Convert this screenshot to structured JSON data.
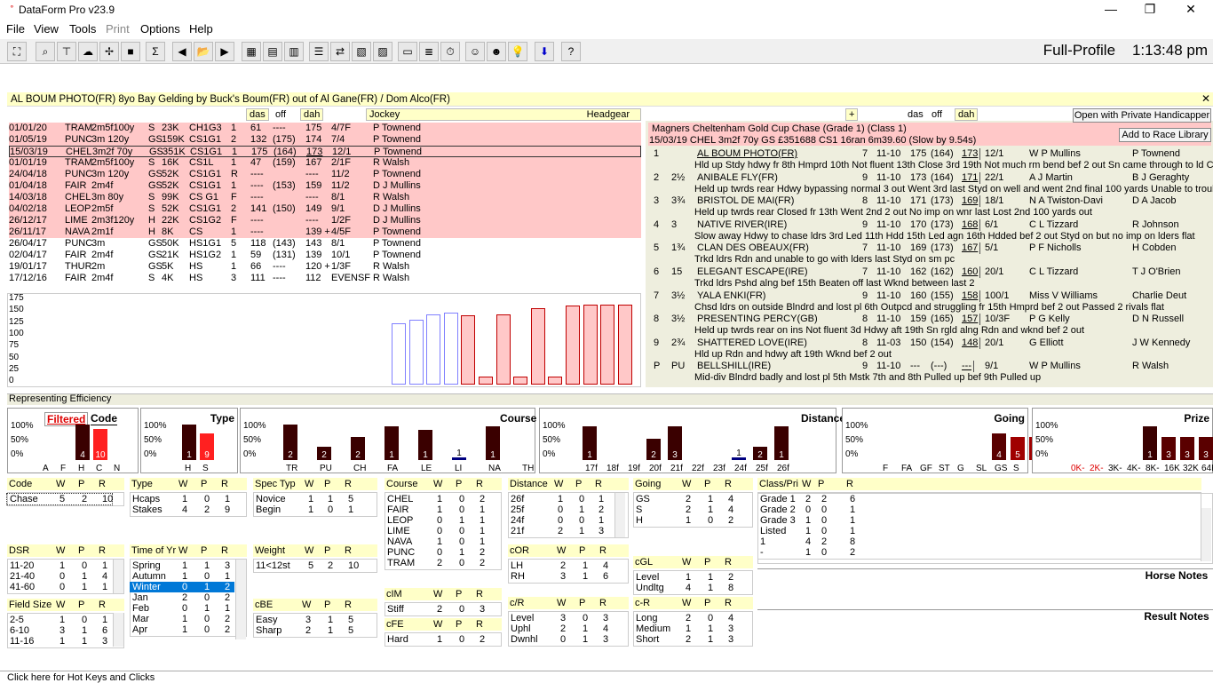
{
  "app": {
    "title": "DataForm Pro v23.9",
    "profile": "Full-Profile",
    "time": "1:13:48 pm"
  },
  "menu": [
    "File",
    "View",
    "Tools",
    "Print",
    "Options",
    "Help"
  ],
  "horse": "AL BOUM PHOTO(FR)    8yo  Bay Gelding  by Buck's Boum(FR) out of Al Gane(FR) / Dom Alco(FR)",
  "form_headers": {
    "das": "das",
    "off": "off",
    "dah": "dah",
    "jockey": "Jockey",
    "headgear": "Headgear"
  },
  "form": [
    {
      "date": "01/01/20",
      "course": "TRAM",
      "dist": "2m5f100y",
      "going": "S",
      "prize": "23K",
      "cls": "CH1G3",
      "pos": "1",
      "das": "61",
      "off": "----",
      "dah": "175",
      "sp": "4/7F",
      "jockey": "P Townend",
      "pink": true
    },
    {
      "date": "01/05/19",
      "course": "PUNC",
      "dist": "3m 120y",
      "going": "GS",
      "prize": "159K",
      "cls": "CS1G1",
      "pos": "2",
      "das": "132",
      "off": "(175)",
      "dah": "174",
      "sp": "7/4",
      "jockey": "P Townend",
      "pink": true
    },
    {
      "date": "15/03/19",
      "course": "CHEL",
      "dist": "3m2f 70y",
      "going": "GS",
      "prize": "351K",
      "cls": "CS1G1",
      "pos": "1",
      "das": "175",
      "off": "(164)",
      "dah": "173",
      "sp": "12/1",
      "jockey": "P Townend",
      "pink": true
    },
    {
      "date": "01/01/19",
      "course": "TRAM",
      "dist": "2m5f100y",
      "going": "S",
      "prize": "16K",
      "cls": "CS1L",
      "pos": "1",
      "das": "47",
      "off": "(159)",
      "dah": "167",
      "sp": "2/1F",
      "jockey": "R Walsh",
      "pink": true
    },
    {
      "date": "24/04/18",
      "course": "PUNC",
      "dist": "3m 120y",
      "going": "GS",
      "prize": "52K",
      "cls": "CS1G1",
      "pos": "R",
      "das": "----",
      "off": "",
      "dah": "----",
      "sp": "11/2",
      "jockey": "P Townend",
      "pink": true
    },
    {
      "date": "01/04/18",
      "course": "FAIR",
      "dist": "2m4f",
      "going": "GS",
      "prize": "52K",
      "cls": "CS1G1",
      "pos": "1",
      "das": "----",
      "off": "(153)",
      "dah": "159",
      "sp": "11/2",
      "jockey": "D J Mullins",
      "pink": true
    },
    {
      "date": "14/03/18",
      "course": "CHEL",
      "dist": "3m  80y",
      "going": "S",
      "prize": "99K",
      "cls": "CS G1",
      "pos": "F",
      "das": "----",
      "off": "",
      "dah": "----",
      "sp": "8/1",
      "jockey": "R Walsh",
      "pink": true
    },
    {
      "date": "04/02/18",
      "course": "LEOP",
      "dist": "2m5f",
      "going": "S",
      "prize": "52K",
      "cls": "CS1G1",
      "pos": "2",
      "das": "141",
      "off": "(150)",
      "dah": "149",
      "sp": "9/1",
      "jockey": "D J Mullins",
      "pink": true
    },
    {
      "date": "26/12/17",
      "course": "LIME",
      "dist": "2m3f120y",
      "going": "H",
      "prize": "22K",
      "cls": "CS1G2",
      "pos": "F",
      "das": "----",
      "off": "",
      "dah": "----",
      "sp": "1/2F",
      "jockey": "D J Mullins",
      "pink": true
    },
    {
      "date": "26/11/17",
      "course": "NAVA",
      "dist": "2m1f",
      "going": "H",
      "prize": "8K",
      "cls": "CS",
      "pos": "1",
      "das": "----",
      "off": "",
      "dah": "139 +",
      "sp": "4/5F",
      "jockey": "P Townend",
      "pink": true
    },
    {
      "date": "26/04/17",
      "course": "PUNC",
      "dist": "3m",
      "going": "GS",
      "prize": "50K",
      "cls": "HS1G1",
      "pos": "5",
      "das": "118",
      "off": "(143)",
      "dah": "143",
      "sp": "8/1",
      "jockey": "P Townend",
      "pink": false
    },
    {
      "date": "02/04/17",
      "course": "FAIR",
      "dist": "2m4f",
      "going": "GS",
      "prize": "21K",
      "cls": "HS1G2",
      "pos": "1",
      "das": "59",
      "off": "(131)",
      "dah": "139",
      "sp": "10/1",
      "jockey": "P Townend",
      "pink": false
    },
    {
      "date": "19/01/17",
      "course": "THUR",
      "dist": "2m",
      "going": "GS",
      "prize": "5K",
      "cls": "HS",
      "pos": "1",
      "das": "66",
      "off": "----",
      "dah": "120 +",
      "sp": "1/3F",
      "jockey": "R Walsh",
      "pink": false
    },
    {
      "date": "17/12/16",
      "course": "FAIR",
      "dist": "2m4f",
      "going": "S",
      "prize": "4K",
      "cls": "HS",
      "pos": "3",
      "das": "111",
      "off": "----",
      "dah": "112",
      "sp": "EVENSF",
      "jockey": "R Walsh",
      "pink": false
    }
  ],
  "rating_chart": {
    "ylabels": [
      "175",
      "150",
      "125",
      "100",
      "75",
      "50",
      "25",
      "0"
    ],
    "values": [
      120,
      127,
      138,
      142,
      137,
      15,
      138,
      15,
      150,
      15,
      155,
      157,
      158,
      158
    ],
    "pink": [
      false,
      false,
      false,
      false,
      true,
      true,
      true,
      true,
      true,
      true,
      true,
      true,
      true,
      true
    ]
  },
  "race": {
    "title": "Magners Cheltenham Gold Cup Chase (Grade 1) (Class 1)",
    "subtitle": "15/03/19 CHEL 3m2f 70y  GS  £351688   CS1 16ran 6m39.60 (Slow by 9.54s)",
    "plus": "+",
    "das": "das",
    "off": "off",
    "dah": "dah",
    "btn_private": "Open with Private Handicapper",
    "btn_library": "Add to Race Library",
    "runners": [
      {
        "pos": "1",
        "btn": "",
        "name": "AL BOUM PHOTO(FR)",
        "age": "7",
        "wt": "11-10",
        "r1": "175",
        "r2": "(164)",
        "r3": "173",
        "sp": "12/1",
        "jockey": "P Townend",
        "trainer": "W P Mullins",
        "comment": "Hld up Stdy hdwy fr 8th Hmprd 10th Not fluent 13th Close 3rd 19th Not much rm bend bef 2 out Sn came through to ld Clr fnl"
      },
      {
        "pos": "2",
        "btn": "2½",
        "name": "ANIBALE FLY(FR)",
        "age": "9",
        "wt": "11-10",
        "r1": "173",
        "r2": "(164)",
        "r3": "171",
        "sp": "22/1",
        "jockey": "B J Geraghty",
        "trainer": "A J Martin",
        "comment": "Held up twrds rear Hdwy bypassing normal 3 out Went 3rd last Styd on well and went 2nd final 100 yards Unable to trouble w"
      },
      {
        "pos": "3",
        "btn": "3¾",
        "name": "BRISTOL DE MAI(FR)",
        "age": "8",
        "wt": "11-10",
        "r1": "171",
        "r2": "(173)",
        "r3": "169",
        "sp": "18/1",
        "jockey": "D A Jacob",
        "trainer": "N A Twiston-Davi",
        "comment": "Held up twrds rear Closed fr 13th Went 2nd 2 out No imp on wnr last Lost 2nd 100 yards out"
      },
      {
        "pos": "4",
        "btn": "3",
        "name": "NATIVE RIVER(IRE)",
        "age": "9",
        "wt": "11-10",
        "r1": "170",
        "r2": "(173)",
        "r3": "168",
        "sp": "6/1",
        "jockey": "R Johnson",
        "trainer": "C L Tizzard",
        "comment": "Slow away Hdwy to chase ldrs 3rd Led 11th Hdd 15th Led agn 16th Hdded bef 2 out Styd on but no imp on lders flat"
      },
      {
        "pos": "5",
        "btn": "1¾",
        "name": "CLAN DES OBEAUX(FR)",
        "age": "7",
        "wt": "11-10",
        "r1": "169",
        "r2": "(173)",
        "r3": "167",
        "sp": "5/1",
        "jockey": "H Cobden",
        "trainer": "P F Nicholls",
        "comment": "Trkd ldrs Rdn and unable to go with lders last Styd on sm pc"
      },
      {
        "pos": "6",
        "btn": "15",
        "name": "ELEGANT ESCAPE(IRE)",
        "age": "7",
        "wt": "11-10",
        "r1": "162",
        "r2": "(162)",
        "r3": "160",
        "sp": "20/1",
        "jockey": "T J O'Brien",
        "trainer": "C L Tizzard",
        "comment": "Trkd ldrs Pshd alng bef 15th Beaten off last Wknd between last 2"
      },
      {
        "pos": "7",
        "btn": "3½",
        "name": "YALA ENKI(FR)",
        "age": "9",
        "wt": "11-10",
        "r1": "160",
        "r2": "(155)",
        "r3": "158",
        "sp": "100/1",
        "jockey": "Charlie Deut",
        "trainer": "Miss V Williams",
        "comment": "Chsd ldrs on outside Blndrd and lost pl 6th Outpcd and struggling fr 15th Hmprd bef 2 out Passed 2 rivals flat"
      },
      {
        "pos": "8",
        "btn": "3½",
        "name": "PRESENTING PERCY(GB)",
        "age": "8",
        "wt": "11-10",
        "r1": "159",
        "r2": "(165)",
        "r3": "157",
        "sp": "10/3F",
        "jockey": "D N Russell",
        "trainer": "P G Kelly",
        "comment": "Held up twrds rear on ins Not fluent 3d Hdwy aft 19th Sn rgld alng Rdn and wknd bef 2 out"
      },
      {
        "pos": "9",
        "btn": "2¾",
        "name": "SHATTERED LOVE(IRE)",
        "age": "8",
        "wt": "11-03",
        "r1": "150",
        "r2": "(154)",
        "r3": "148",
        "sp": "20/1",
        "jockey": "J W Kennedy",
        "trainer": "G Elliott",
        "comment": "Hld up Rdn and hdwy aft 19th Wknd bef 2 out"
      },
      {
        "pos": "P",
        "btn": "PU",
        "name": "BELLSHILL(IRE)",
        "age": "9",
        "wt": "11-10",
        "r1": "---",
        "r2": "(---)",
        "r3": "---",
        "sp": "9/1",
        "jockey": "R Walsh",
        "trainer": "W P Mullins",
        "comment": "Mid-div Blndrd badly and lost pl 5th Mstk 7th and 8th Pulled up bef 9th Pulled up"
      }
    ]
  },
  "efficiency_label": "Representing Efficiency",
  "panels": [
    {
      "title": "Code",
      "filtered": "Filtered",
      "labels": [
        "A",
        "F",
        "H",
        "C",
        "N"
      ],
      "bars": [
        0,
        0,
        40,
        35,
        0
      ],
      "counts": [
        "",
        "",
        "4",
        "10",
        ""
      ],
      "colors": [
        "",
        "",
        "#3a0000",
        "#ff2020",
        ""
      ]
    },
    {
      "title": "Type",
      "labels": [
        "H",
        "S"
      ],
      "bars": [
        40,
        30
      ],
      "counts": [
        "1",
        "9"
      ],
      "colors": [
        "#3a0000",
        "#ff2020"
      ]
    },
    {
      "title": "Course",
      "labels": [
        "TR",
        "PU",
        "CH",
        "FA",
        "LE",
        "LI",
        "NA",
        "TH"
      ],
      "bars": [
        40,
        15,
        26,
        38,
        34,
        3,
        38,
        0
      ],
      "counts": [
        "2",
        "2",
        "2",
        "1",
        "1",
        "1",
        "1",
        ""
      ],
      "colors": [
        "#3a0000",
        "#3a0000",
        "#3a0000",
        "#3a0000",
        "#3a0000",
        "#000080",
        "#3a0000",
        ""
      ]
    },
    {
      "title": "Distance",
      "labels": [
        "17f",
        "18f",
        "19f",
        "20f",
        "21f",
        "22f",
        "23f",
        "24f",
        "25f",
        "26f"
      ],
      "bars": [
        38,
        0,
        0,
        24,
        38,
        0,
        0,
        3,
        15,
        38
      ],
      "counts": [
        "1",
        "",
        "",
        "2",
        "3",
        "",
        "",
        "1",
        "2",
        "1"
      ],
      "colors": [
        "#3a0000",
        "",
        "",
        "#3a0000",
        "#3a0000",
        "",
        "",
        "#000080",
        "#3a0000",
        "#3a0000"
      ]
    },
    {
      "title": "Going",
      "labels": [
        "F",
        "FA",
        "GF",
        "ST",
        "G",
        "SL",
        "GS",
        "S",
        "H"
      ],
      "bars": [
        0,
        0,
        0,
        0,
        0,
        0,
        30,
        26,
        26
      ],
      "counts": [
        "",
        "",
        "",
        "",
        "",
        "",
        "4",
        "5",
        "2"
      ],
      "colors": [
        "",
        "",
        "",
        "",
        "",
        "",
        "#5a0000",
        "#a00000",
        "#a00000"
      ]
    },
    {
      "title": "Prize",
      "labels": [
        "0K-",
        "2K-",
        "3K-",
        "4K-",
        "8K-",
        "16K",
        "32K",
        "64K+"
      ],
      "bars": [
        0,
        0,
        0,
        0,
        38,
        26,
        26,
        26
      ],
      "counts": [
        "",
        "",
        "",
        "",
        "1",
        "3",
        "3",
        "3"
      ],
      "colors": [
        "",
        "",
        "",
        "",
        "#3a0000",
        "#5a0000",
        "#5a0000",
        "#5a0000"
      ]
    }
  ],
  "ylab": [
    "100%",
    "50%",
    "0%"
  ],
  "stat_tables": {
    "code": {
      "h": "Code",
      "rows": [
        [
          "Chase",
          "5",
          "2",
          "10"
        ]
      ]
    },
    "type": {
      "h": "Type",
      "rows": [
        [
          "Hcaps",
          "1",
          "0",
          "1"
        ],
        [
          "Stakes",
          "4",
          "2",
          "9"
        ]
      ]
    },
    "spec": {
      "h": "Spec Typ",
      "rows": [
        [
          "Novice",
          "1",
          "1",
          "5"
        ],
        [
          "Begin",
          "1",
          "0",
          "1"
        ]
      ]
    },
    "course": {
      "h": "Course",
      "rows": [
        [
          "CHEL",
          "1",
          "0",
          "2"
        ],
        [
          "FAIR",
          "1",
          "0",
          "1"
        ],
        [
          "LEOP",
          "0",
          "1",
          "1"
        ],
        [
          "LIME",
          "0",
          "0",
          "1"
        ],
        [
          "NAVA",
          "1",
          "0",
          "1"
        ],
        [
          "PUNC",
          "0",
          "1",
          "2"
        ],
        [
          "TRAM",
          "2",
          "0",
          "2"
        ]
      ]
    },
    "distance": {
      "h": "Distance",
      "rows": [
        [
          "26f",
          "1",
          "0",
          "1"
        ],
        [
          "25f",
          "0",
          "1",
          "2"
        ],
        [
          "24f",
          "0",
          "0",
          "1"
        ],
        [
          "21f",
          "2",
          "1",
          "3"
        ]
      ]
    },
    "going": {
      "h": "Going",
      "rows": [
        [
          "GS",
          "2",
          "1",
          "4"
        ],
        [
          "S",
          "2",
          "1",
          "4"
        ],
        [
          "H",
          "1",
          "0",
          "2"
        ]
      ]
    },
    "classpri": {
      "h": "Class/Pri",
      "rows": [
        [
          "Grade 1",
          "2",
          "2",
          "6"
        ],
        [
          "Grade 2",
          "0",
          "0",
          "1"
        ],
        [
          "Grade 3",
          "1",
          "0",
          "1"
        ],
        [
          "Listed",
          "1",
          "0",
          "1"
        ],
        [
          "1",
          "4",
          "2",
          "8"
        ],
        [
          "-",
          "1",
          "0",
          "2"
        ]
      ]
    },
    "dsr": {
      "h": "DSR",
      "rows": [
        [
          "11-20",
          "1",
          "0",
          "1"
        ],
        [
          "21-40",
          "0",
          "1",
          "4"
        ],
        [
          "41-60",
          "0",
          "1",
          "1"
        ]
      ]
    },
    "time": {
      "h": "Time of Yr",
      "rows": [
        [
          "Spring",
          "1",
          "1",
          "3"
        ],
        [
          "Autumn",
          "1",
          "0",
          "1"
        ],
        [
          "Winter",
          "0",
          "1",
          "2"
        ],
        [
          "Jan",
          "2",
          "0",
          "2"
        ],
        [
          "Feb",
          "0",
          "1",
          "1"
        ],
        [
          "Mar",
          "1",
          "0",
          "2"
        ],
        [
          "Apr",
          "1",
          "0",
          "2"
        ]
      ]
    },
    "weight": {
      "h": "Weight",
      "rows": [
        [
          "11<12st",
          "5",
          "2",
          "10"
        ]
      ]
    },
    "cor": {
      "h": "cOR",
      "rows": [
        [
          "LH",
          "2",
          "1",
          "4"
        ],
        [
          "RH",
          "3",
          "1",
          "6"
        ]
      ]
    },
    "cgl": {
      "h": "cGL",
      "rows": [
        [
          "Level",
          "1",
          "1",
          "2"
        ],
        [
          "Undltg",
          "4",
          "1",
          "8"
        ]
      ]
    },
    "fs": {
      "h": "Field Size",
      "rows": [
        [
          "2-5",
          "1",
          "0",
          "1"
        ],
        [
          "6-10",
          "3",
          "1",
          "6"
        ],
        [
          "11-16",
          "1",
          "1",
          "3"
        ]
      ]
    },
    "cbe": {
      "h": "cBE",
      "rows": [
        [
          "Easy",
          "3",
          "1",
          "5"
        ],
        [
          "Sharp",
          "2",
          "1",
          "5"
        ]
      ]
    },
    "clm": {
      "h": "cIM",
      "rows": [
        [
          "Stiff",
          "2",
          "0",
          "3"
        ]
      ]
    },
    "cfe": {
      "h": "cFE",
      "rows": [
        [
          "Hard",
          "1",
          "0",
          "2"
        ]
      ]
    },
    "cr": {
      "h": "c/R",
      "rows": [
        [
          "Level",
          "3",
          "0",
          "3"
        ],
        [
          "Uphl",
          "2",
          "1",
          "4"
        ],
        [
          "Dwnhl",
          "0",
          "1",
          "3"
        ]
      ]
    },
    "cr2": {
      "h": "c-R",
      "rows": [
        [
          "Long",
          "2",
          "0",
          "4"
        ],
        [
          "Medium",
          "1",
          "1",
          "3"
        ],
        [
          "Short",
          "2",
          "1",
          "3"
        ]
      ]
    }
  },
  "wpr": [
    "W",
    "P",
    "R"
  ],
  "horse_notes": "Horse Notes",
  "result_notes": "Result Notes",
  "status": "Click here for Hot Keys and Clicks"
}
